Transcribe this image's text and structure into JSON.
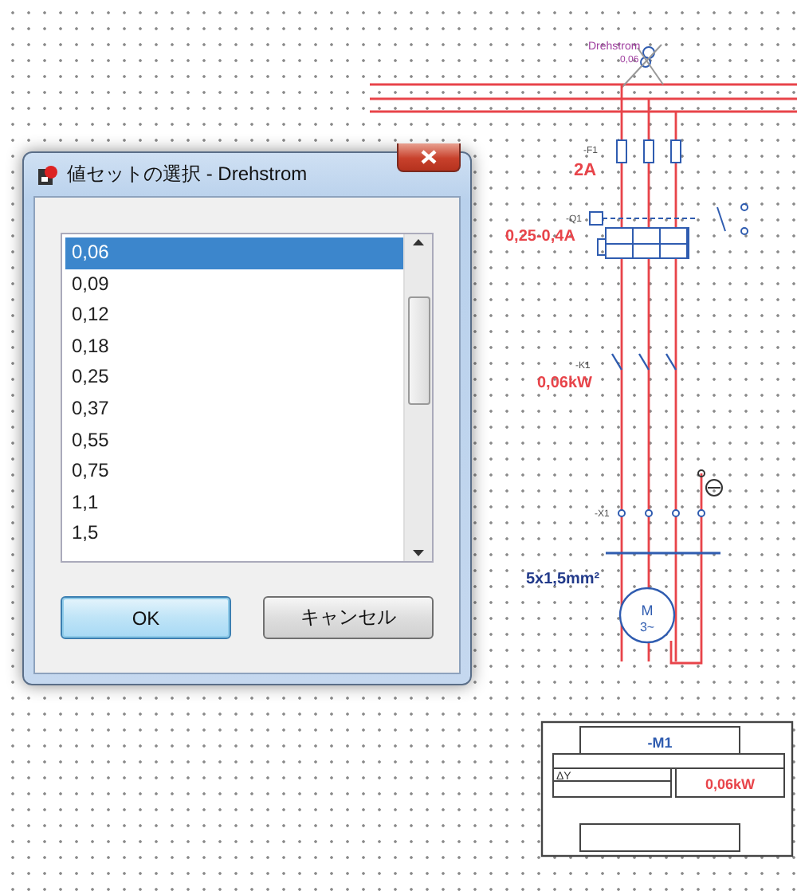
{
  "schematic": {
    "supply": {
      "name": "Drehstrom",
      "value": "0,06"
    },
    "fuse": {
      "tag": "-F1",
      "rating": "2A"
    },
    "breaker": {
      "tag": "-Q1",
      "range": "0,25-0,4A"
    },
    "contactor": {
      "tag": "-K1",
      "power": "0,06kW"
    },
    "terminal": {
      "tag": "-X1"
    },
    "cable": {
      "spec": "5x1,5mm²"
    },
    "motor": {
      "symbol": "M",
      "phase": "3~"
    },
    "title_block": {
      "tag": "-M1",
      "connection": "ΔY",
      "power": "0,06kW"
    }
  },
  "dialog": {
    "title": "値セットの選択 - Drehstrom",
    "options": [
      {
        "label": "0,06",
        "selected": true
      },
      {
        "label": "0,09",
        "selected": false
      },
      {
        "label": "0,12",
        "selected": false
      },
      {
        "label": "0,18",
        "selected": false
      },
      {
        "label": "0,25",
        "selected": false
      },
      {
        "label": "0,37",
        "selected": false
      },
      {
        "label": "0,55",
        "selected": false
      },
      {
        "label": "0,75",
        "selected": false
      },
      {
        "label": "1,1",
        "selected": false
      },
      {
        "label": "1,5",
        "selected": false
      }
    ],
    "buttons": [
      {
        "label": "OK",
        "default": true
      },
      {
        "label": "キャンセル",
        "default": false
      }
    ]
  }
}
